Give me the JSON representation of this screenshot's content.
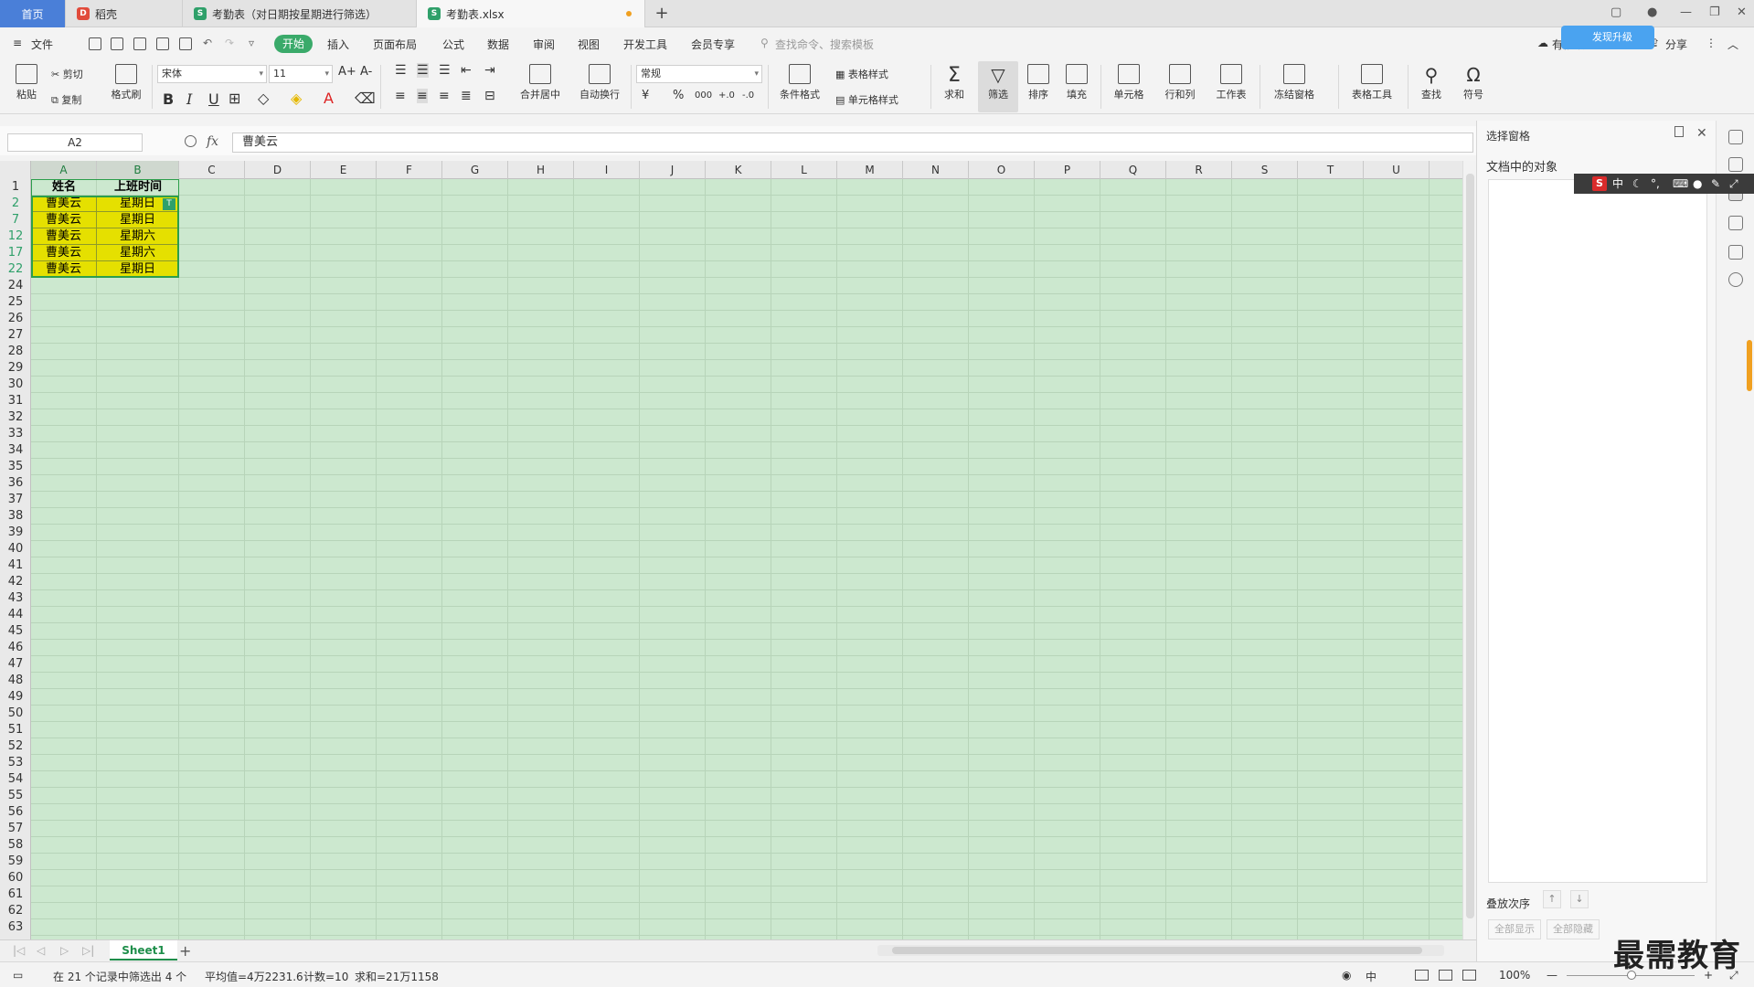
{
  "tabs": {
    "home": "首页",
    "daoke": "稻壳",
    "sheet_a": "考勤表（对日期按星期进行筛选）",
    "sheet_b": "考勤表.xlsx",
    "add": "+"
  },
  "menu": {
    "file": "文件",
    "start": "开始",
    "items": [
      "插入",
      "页面布局",
      "公式",
      "数据",
      "审阅",
      "视图",
      "开发工具",
      "会员专享"
    ],
    "search": "查找命令、搜索模板",
    "unsynced": "有修改",
    "cloud": "发现升级",
    "share": "分享"
  },
  "ribbon": {
    "paste": "粘贴",
    "cut": "剪切",
    "copy": "复制",
    "format_painter": "格式刷",
    "font_name": "宋体",
    "font_size": "11",
    "merge_center": "合并居中",
    "wrap_text": "自动换行",
    "number_format": "常规",
    "table_style": "表格样式",
    "cond_format": "条件格式",
    "cell_style": "单元格样式",
    "sum": "求和",
    "filter": "筛选",
    "sort": "排序",
    "fill": "填充",
    "cell": "单元格",
    "row_col": "行和列",
    "worksheet": "工作表",
    "freeze": "冻结窗格",
    "table_tools": "表格工具",
    "find": "查找",
    "symbol": "符号",
    "bold": "B",
    "italic": "I",
    "underline": "U",
    "currency": "¥",
    "percent": "%",
    "thousands": "000",
    "inc_decimal": "+.0",
    "dec_decimal": "-.0",
    "font_grow": "A+",
    "font_shrink": "A-",
    "font_color": "A",
    "sigma": "Σ"
  },
  "formula_bar": {
    "name_box": "A2",
    "fx": "fx",
    "content": "曹美云"
  },
  "columns": [
    "A",
    "B",
    "C",
    "D",
    "E",
    "F",
    "G",
    "H",
    "I",
    "J",
    "K",
    "L",
    "M",
    "N",
    "O",
    "P",
    "Q",
    "R",
    "S",
    "T",
    "U"
  ],
  "rows": [
    "1",
    "2",
    "7",
    "12",
    "17",
    "22",
    "24",
    "25",
    "26",
    "27",
    "28",
    "29",
    "30",
    "31",
    "32",
    "33",
    "34",
    "35",
    "36",
    "37",
    "38",
    "39",
    "40",
    "41",
    "42",
    "43",
    "44",
    "45",
    "46",
    "47",
    "48",
    "49",
    "50",
    "51",
    "52",
    "53",
    "54",
    "55",
    "56",
    "57",
    "58",
    "59",
    "60",
    "61",
    "62",
    "63"
  ],
  "table": {
    "headers": [
      "姓名",
      "上班时间"
    ],
    "data": [
      [
        "曹美云",
        "星期日"
      ],
      [
        "曹美云",
        "星期日"
      ],
      [
        "曹美云",
        "星期六"
      ],
      [
        "曹美云",
        "星期六"
      ],
      [
        "曹美云",
        "星期日"
      ]
    ]
  },
  "sheet_tabs": [
    "Sheet1"
  ],
  "status": {
    "filter_info": "在 21 个记录中筛选出 4 个",
    "average": "平均值=4万2231.6",
    "count": "计数=10",
    "sum": "求和=21万1158",
    "zoom": "100%",
    "lang": "中"
  },
  "side_pane": {
    "title": "选择窗格",
    "objects_label": "文档中的对象",
    "order_label": "叠放次序",
    "show_all": "全部显示",
    "hide_all": "全部隐藏"
  },
  "ime": {
    "s": "S",
    "mode": "中"
  },
  "watermark": "最需教育",
  "colors": {
    "accent": "#3aaa6a",
    "grid_bg": "#cce8cf",
    "highlight": "#e5e000",
    "home_tab": "#4a7fd8"
  }
}
